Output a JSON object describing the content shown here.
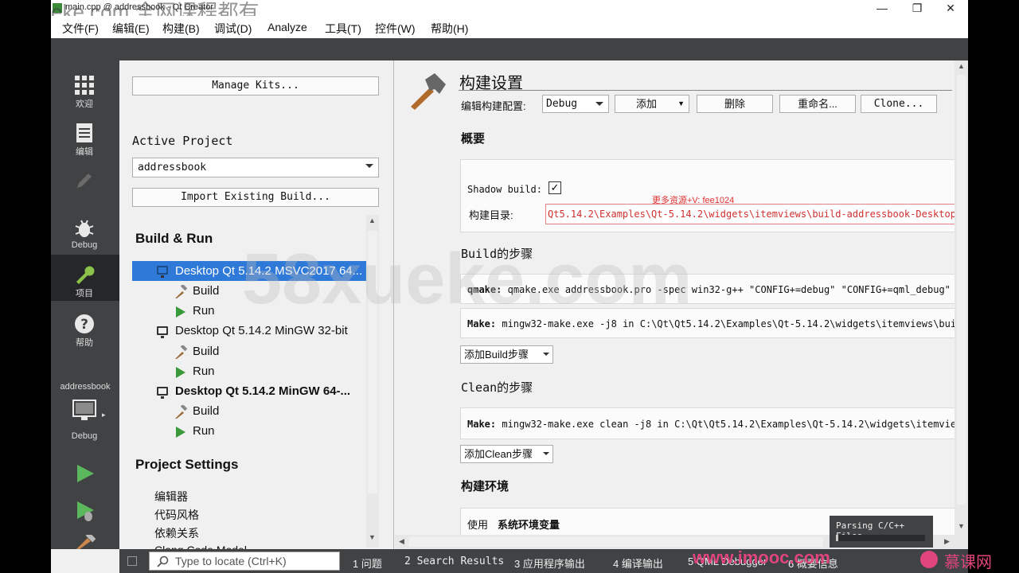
{
  "window": {
    "title": "main.cpp @ addressbook - Qt Creator",
    "watermark": "eke.com 全网课程都有"
  },
  "menu": [
    "文件(F)",
    "编辑(E)",
    "构建(B)",
    "调试(D)",
    "Analyze",
    "工具(T)",
    "控件(W)",
    "帮助(H)"
  ],
  "modes": [
    {
      "label": "欢迎",
      "icon": "grid-icon"
    },
    {
      "label": "编辑",
      "icon": "document-icon"
    },
    {
      "label": "",
      "icon": "pencil-icon"
    },
    {
      "label": "Debug",
      "icon": "bug-icon"
    },
    {
      "label": "项目",
      "icon": "wrench-icon"
    },
    {
      "label": "帮助",
      "icon": "help-icon"
    }
  ],
  "target": {
    "project": "addressbook",
    "mode": "Debug"
  },
  "left": {
    "manage_kits": "Manage Kits...",
    "active_project_label": "Active Project",
    "active_project_value": "addressbook",
    "import_build": "Import Existing Build...",
    "build_run_heading": "Build & Run",
    "kits": [
      {
        "name": "Desktop Qt 5.14.2 MSVC2017 64...",
        "build": "Build",
        "run": "Run"
      },
      {
        "name": "Desktop Qt 5.14.2 MinGW 32-bit",
        "build": "Build",
        "run": "Run"
      },
      {
        "name": "Desktop Qt 5.14.2 MinGW 64-...",
        "build": "Build",
        "run": "Run"
      }
    ],
    "project_settings_heading": "Project Settings",
    "settings": [
      "编辑器",
      "代码风格",
      "依赖关系",
      "Clang Code Model"
    ]
  },
  "right": {
    "title": "构建设置",
    "edit_config_label": "编辑构建配置:",
    "config_value": "Debug",
    "add_button": "添加",
    "delete_button": "删除",
    "rename_button": "重命名...",
    "clone_button": "Clone...",
    "overview_heading": "概要",
    "shadow_build_label": "Shadow build:",
    "shadow_build_checked": "✓",
    "build_dir_label": "构建目录:",
    "build_dir_value": "Qt5.14.2\\Examples\\Qt-5.14.2\\widgets\\itemviews\\build-addressbook-Desktop",
    "overlay_text": "更多资源+V: fee1024",
    "build_steps_heading": "Build的步骤",
    "qmake_label": "qmake:",
    "qmake_value": "qmake.exe addressbook.pro -spec win32-g++ \"CONFIG+=debug\" \"CONFIG+=qml_debug\"",
    "make_label": "Make:",
    "make_value": "mingw32-make.exe -j8 in C:\\Qt\\Qt5.14.2\\Examples\\Qt-5.14.2\\widgets\\itemviews\\bui",
    "add_build_step": "添加Build步骤",
    "clean_steps_heading": "Clean的步骤",
    "clean_make_label": "Make:",
    "clean_make_value": "mingw32-make.exe clean -j8 in C:\\Qt\\Qt5.14.2\\Examples\\Qt-5.14.2\\widgets\\itemvie",
    "add_clean_step": "添加Clean步骤",
    "env_heading": "构建环境",
    "env_use": "使用",
    "env_value": "系统环境变量"
  },
  "bottom": {
    "locator_placeholder": "Type to locate (Ctrl+K)",
    "tabs": [
      "1 问题",
      "2 Search Results",
      "3 应用程序输出",
      "4 编译输出",
      "5 QML Debugger",
      "6 概要信息"
    ]
  },
  "parsing_text": "Parsing C/C++ Files",
  "branding": {
    "url": "www.imooc.com",
    "name": "慕课网"
  }
}
